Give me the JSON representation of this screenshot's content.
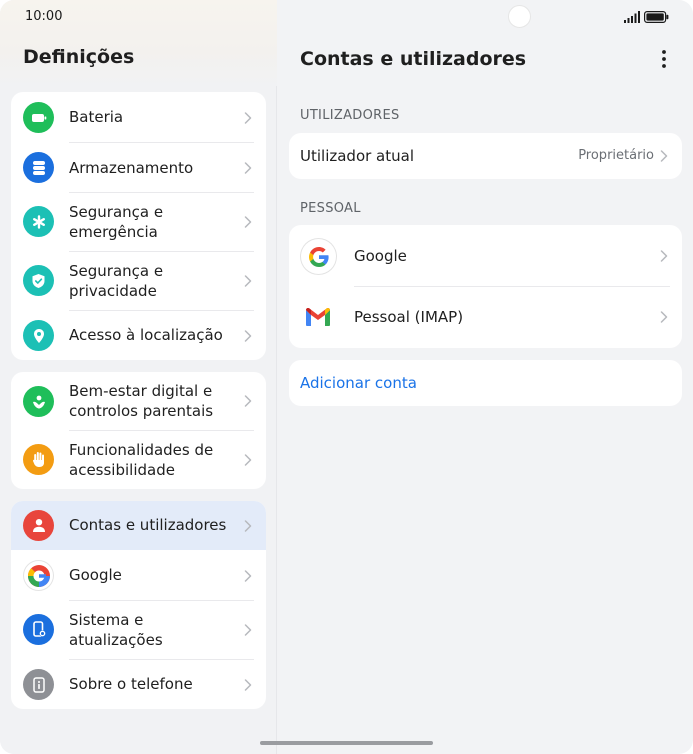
{
  "status_bar": {
    "time": "10:00"
  },
  "left": {
    "title": "Definições",
    "group1": [
      {
        "label": "Bateria",
        "icon": "battery-icon",
        "color": "#1fbe5a"
      },
      {
        "label": "Armazenamento",
        "icon": "storage-icon",
        "color": "#1b6fde"
      },
      {
        "label": "Segurança e emergência",
        "icon": "emergency-icon",
        "color": "#1cc0b5"
      },
      {
        "label": "Segurança e privacidade",
        "icon": "shield-icon",
        "color": "#1cc0b5"
      },
      {
        "label": "Acesso à localização",
        "icon": "location-pin-icon",
        "color": "#1cc0b5"
      }
    ],
    "group2": [
      {
        "label": "Bem-estar digital e controlos parentais",
        "icon": "wellbeing-icon",
        "color": "#1fbe5a"
      },
      {
        "label": "Funcionalidades de acessibilidade",
        "icon": "hand-icon",
        "color": "#f39c12"
      }
    ],
    "group3": [
      {
        "label": "Contas e utilizadores",
        "icon": "user-icon",
        "color": "#e8453c",
        "active": true
      },
      {
        "label": "Google",
        "icon": "google-icon",
        "color": "#ffffff"
      },
      {
        "label": "Sistema e atualizações",
        "icon": "phone-settings-icon",
        "color": "#1b6fde"
      },
      {
        "label": "Sobre o telefone",
        "icon": "info-icon",
        "color": "#8e9095"
      }
    ]
  },
  "right": {
    "title": "Contas e utilizadores",
    "section_users": "UTILIZADORES",
    "current_user_label": "Utilizador atual",
    "current_user_value": "Proprietário",
    "section_personal": "PESSOAL",
    "accounts": [
      {
        "label": "Google",
        "icon": "google-icon"
      },
      {
        "label": "Pessoal (IMAP)",
        "icon": "gmail-icon"
      }
    ],
    "add_account": "Adicionar conta"
  },
  "colors": {
    "accent": "#1a73e8",
    "active_row": "#e3ebf9"
  }
}
